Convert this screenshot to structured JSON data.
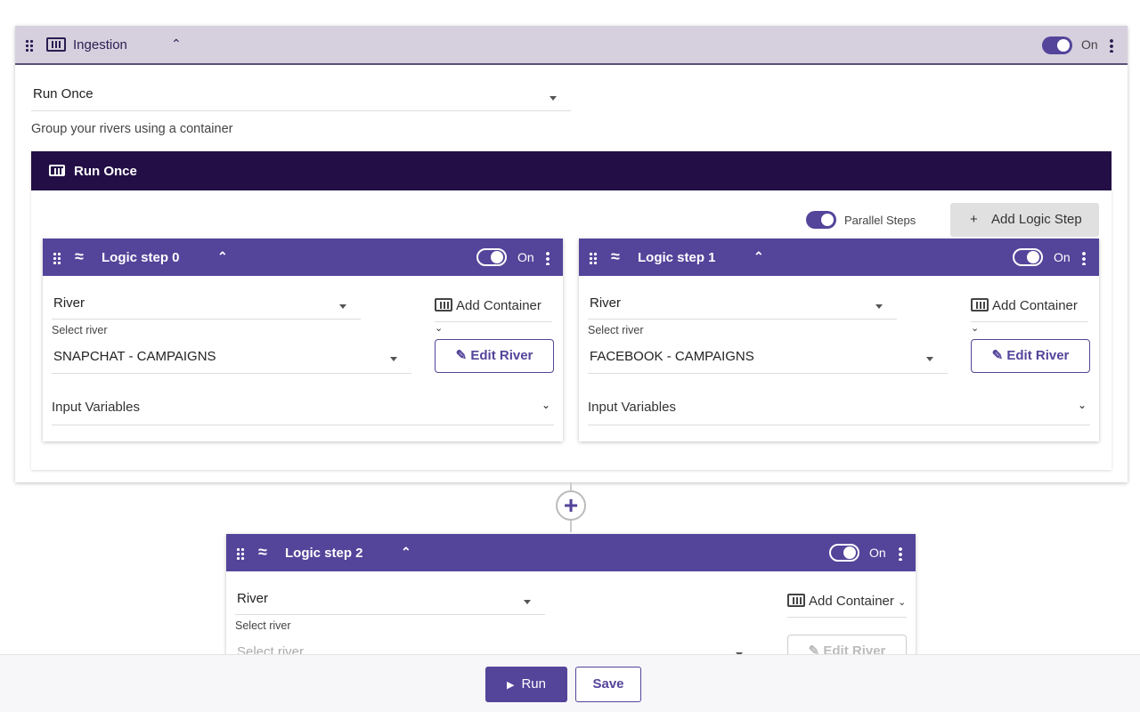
{
  "ingestion": {
    "title": "Ingestion",
    "toggle_label": "On",
    "toggle_on": true,
    "schedule": "Run Once",
    "hint": "Group your rivers using a container"
  },
  "container": {
    "title": "Run Once",
    "parallel_label": "Parallel Steps",
    "parallel_on": true,
    "add_step": "Add Logic Step",
    "add_icon": "+"
  },
  "steps": [
    {
      "title": "Logic step 0",
      "toggle": "On",
      "type": "River",
      "select_label": "Select river",
      "river": "SNAPCHAT - CAMPAIGNS",
      "add_container": "Add Container",
      "edit": "Edit River",
      "input_vars": "Input Variables"
    },
    {
      "title": "Logic step 1",
      "toggle": "On",
      "type": "River",
      "select_label": "Select river",
      "river": "FACEBOOK - CAMPAIGNS",
      "add_container": "Add Container",
      "edit": "Edit River",
      "input_vars": "Input Variables"
    },
    {
      "title": "Logic step 2",
      "toggle": "On",
      "type": "River",
      "select_label": "Select river",
      "river_placeholder": "Select river",
      "add_container": "Add Container",
      "edit": "Edit River"
    }
  ],
  "footer": {
    "run": "Run",
    "save": "Save"
  },
  "colors": {
    "primary": "#54449a",
    "dark": "#230f45",
    "header_bg": "#d6d0de"
  }
}
